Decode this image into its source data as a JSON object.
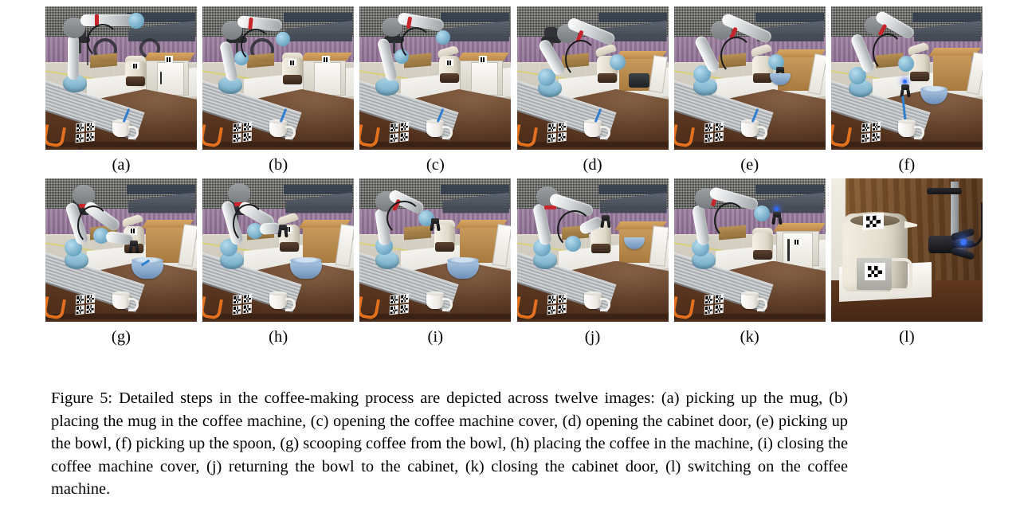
{
  "figure": {
    "id": "figure-5",
    "number": "Figure 5",
    "caption": "Figure 5: Detailed steps in the coffee-making process are depicted across twelve images: (a) picking up the mug, (b) placing the mug in the coffee machine, (c) opening the coffee machine cover, (d) opening the cabinet door, (e) picking up the bowl, (f) picking up the spoon, (g) scooping coffee from the bowl, (h) placing the coffee in the machine, (i) closing the coffee machine cover, (j) returning the bowl to the cabinet, (k) closing the cabinet door, (l) switching on the coffee machine.",
    "layout": {
      "rows": 2,
      "columns": 6,
      "total_panels": 12
    }
  },
  "panels": [
    {
      "label": "(a)",
      "step": "picking up the mug",
      "scene": "robot-workcell"
    },
    {
      "label": "(b)",
      "step": "placing the mug in the coffee machine",
      "scene": "robot-workcell"
    },
    {
      "label": "(c)",
      "step": "opening the coffee machine cover",
      "scene": "robot-workcell"
    },
    {
      "label": "(d)",
      "step": "opening the cabinet door",
      "scene": "robot-workcell"
    },
    {
      "label": "(e)",
      "step": "picking up the bowl",
      "scene": "robot-workcell"
    },
    {
      "label": "(f)",
      "step": "picking up the spoon",
      "scene": "robot-workcell"
    },
    {
      "label": "(g)",
      "step": "scooping coffee from the bowl",
      "scene": "robot-workcell"
    },
    {
      "label": "(h)",
      "step": "placing the coffee in the machine",
      "scene": "robot-workcell"
    },
    {
      "label": "(i)",
      "step": "closing the coffee machine cover",
      "scene": "robot-workcell"
    },
    {
      "label": "(j)",
      "step": "returning the bowl to the cabinet",
      "scene": "robot-workcell"
    },
    {
      "label": "(k)",
      "step": "closing the cabinet door",
      "scene": "robot-workcell"
    },
    {
      "label": "(l)",
      "step": "switching on the coffee machine",
      "scene": "machine-closeup"
    }
  ],
  "colors": {
    "page_background": "#ffffff",
    "text": "#000000",
    "table_wood": "#55331e",
    "robot_joint_blue": "#6ea7c4",
    "robot_link_white": "#d6d9db",
    "robot_accent_red": "#c8242c",
    "bowl_blue": "#6d8fb8",
    "spoon_blue": "#2f7fd0",
    "clamp_orange": "#e2701f",
    "cabinet_wood": "#b9854a",
    "coffee_machine_cream": "#e3ddcd",
    "gripper_black": "#18181b",
    "led_blue": "#3a74ff",
    "floor": "#cfc9ba",
    "mats_purple": "#8e6f93",
    "mesh_gray": "#777874"
  }
}
